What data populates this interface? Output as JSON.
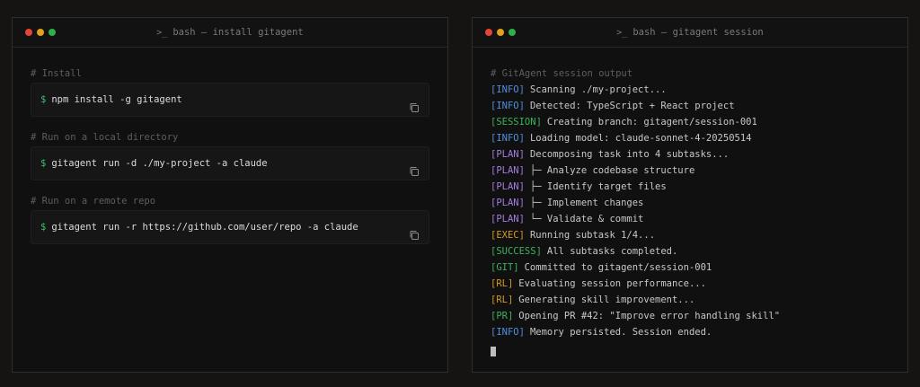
{
  "colors": {
    "dot_red": "#e5443b",
    "dot_yellow": "#e3a319",
    "dot_green": "#2fb14a",
    "prompt": "#3cc06b",
    "INFO": "#4f8fe0",
    "SESSION": "#3cb35a",
    "PLAN": "#a57be0",
    "EXEC": "#d69a22",
    "SUCCESS": "#3cb35a",
    "GIT": "#3cb35a",
    "RL": "#d69a22",
    "PR": "#3cb35a"
  },
  "left_window": {
    "title": "bash — install gitagent",
    "title_icon": "terminal-icon",
    "prompt_symbol": "$",
    "copy_icon": "copy-icon",
    "blocks": [
      {
        "comment": "# Install",
        "command": "npm install -g gitagent"
      },
      {
        "comment": "# Run on a local directory",
        "command": "gitagent run -d ./my-project -a claude"
      },
      {
        "comment": "# Run on a remote repo",
        "command": "gitagent run -r https://github.com/user/repo -a claude"
      }
    ]
  },
  "right_window": {
    "title": "bash — gitagent session",
    "title_icon": "terminal-icon",
    "comment": "# GitAgent session output",
    "lines": [
      {
        "tag": "[INFO]",
        "kind": "INFO",
        "text": "Scanning ./my-project..."
      },
      {
        "tag": "[INFO]",
        "kind": "INFO",
        "text": "Detected: TypeScript + React project"
      },
      {
        "tag": "[SESSION]",
        "kind": "SESSION",
        "text": "Creating branch: gitagent/session-001"
      },
      {
        "tag": "[INFO]",
        "kind": "INFO",
        "text": "Loading model: claude-sonnet-4-20250514"
      },
      {
        "tag": "[PLAN]",
        "kind": "PLAN",
        "text": "Decomposing task into 4 subtasks..."
      },
      {
        "tag": "[PLAN]",
        "kind": "PLAN",
        "text": "├─ Analyze codebase structure"
      },
      {
        "tag": "[PLAN]",
        "kind": "PLAN",
        "text": "├─ Identify target files"
      },
      {
        "tag": "[PLAN]",
        "kind": "PLAN",
        "text": "├─ Implement changes"
      },
      {
        "tag": "[PLAN]",
        "kind": "PLAN",
        "text": "└─ Validate & commit"
      },
      {
        "tag": "[EXEC]",
        "kind": "EXEC",
        "text": "Running subtask 1/4..."
      },
      {
        "tag": "[SUCCESS]",
        "kind": "SUCCESS",
        "text": "All subtasks completed."
      },
      {
        "tag": "[GIT]",
        "kind": "GIT",
        "text": "Committed to gitagent/session-001"
      },
      {
        "tag": "[RL]",
        "kind": "RL",
        "text": "Evaluating session performance..."
      },
      {
        "tag": "[RL]",
        "kind": "RL",
        "text": "Generating skill improvement..."
      },
      {
        "tag": "[PR]",
        "kind": "PR",
        "text": "Opening PR #42: \"Improve error handling skill\""
      },
      {
        "tag": "[INFO]",
        "kind": "INFO",
        "text": "Memory persisted. Session ended."
      }
    ]
  }
}
